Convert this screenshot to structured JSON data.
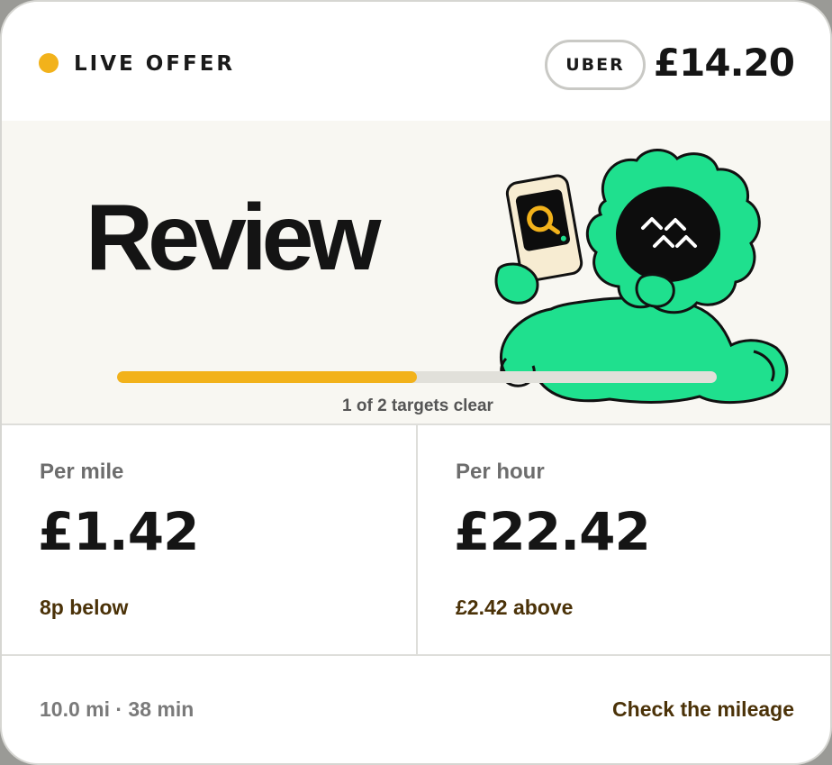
{
  "header": {
    "status_label": "LIVE OFFER",
    "status_color": "#f2b21b",
    "provider": "UBER",
    "fare": "£14.20"
  },
  "hero": {
    "verdict": "Review",
    "mascot_icon": "green-furry-monster-with-phone-search-icon",
    "progress": {
      "fraction": 0.5,
      "label": "1 of 2 targets clear",
      "fill_color": "#f2b21b"
    }
  },
  "metrics": [
    {
      "label": "Per mile",
      "value": "£1.42",
      "delta": "8p below"
    },
    {
      "label": "Per hour",
      "value": "£22.42",
      "delta": "£2.42 above"
    }
  ],
  "footer": {
    "trip_summary": "10.0 mi · 38 min",
    "action_label": "Check the mileage"
  }
}
